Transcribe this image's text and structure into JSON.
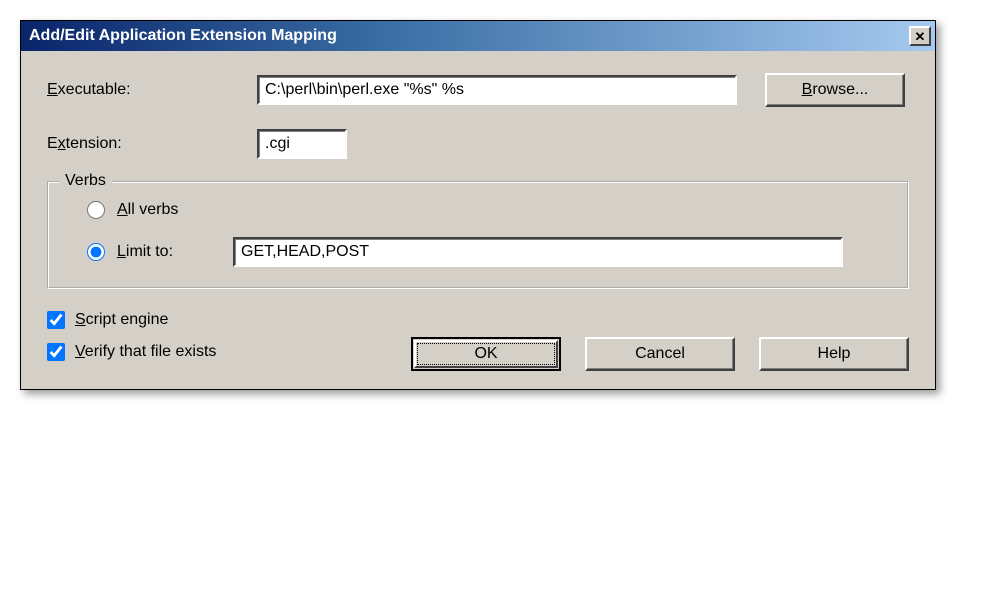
{
  "title": "Add/Edit Application Extension Mapping",
  "executable": {
    "label": "Executable:",
    "value": "C:\\perl\\bin\\perl.exe \"%s\" %s"
  },
  "extension": {
    "label": "Extension:",
    "value": ".cgi"
  },
  "browse_label": "Browse...",
  "verbs": {
    "legend": "Verbs",
    "all_label": "All verbs",
    "limit_label": "Limit to:",
    "limit_value": "GET,HEAD,POST",
    "selected": "limit"
  },
  "script_engine_label": "Script engine",
  "verify_label": "Verify that file exists",
  "script_engine_checked": true,
  "verify_checked": true,
  "ok_label": "OK",
  "cancel_label": "Cancel",
  "help_label": "Help"
}
